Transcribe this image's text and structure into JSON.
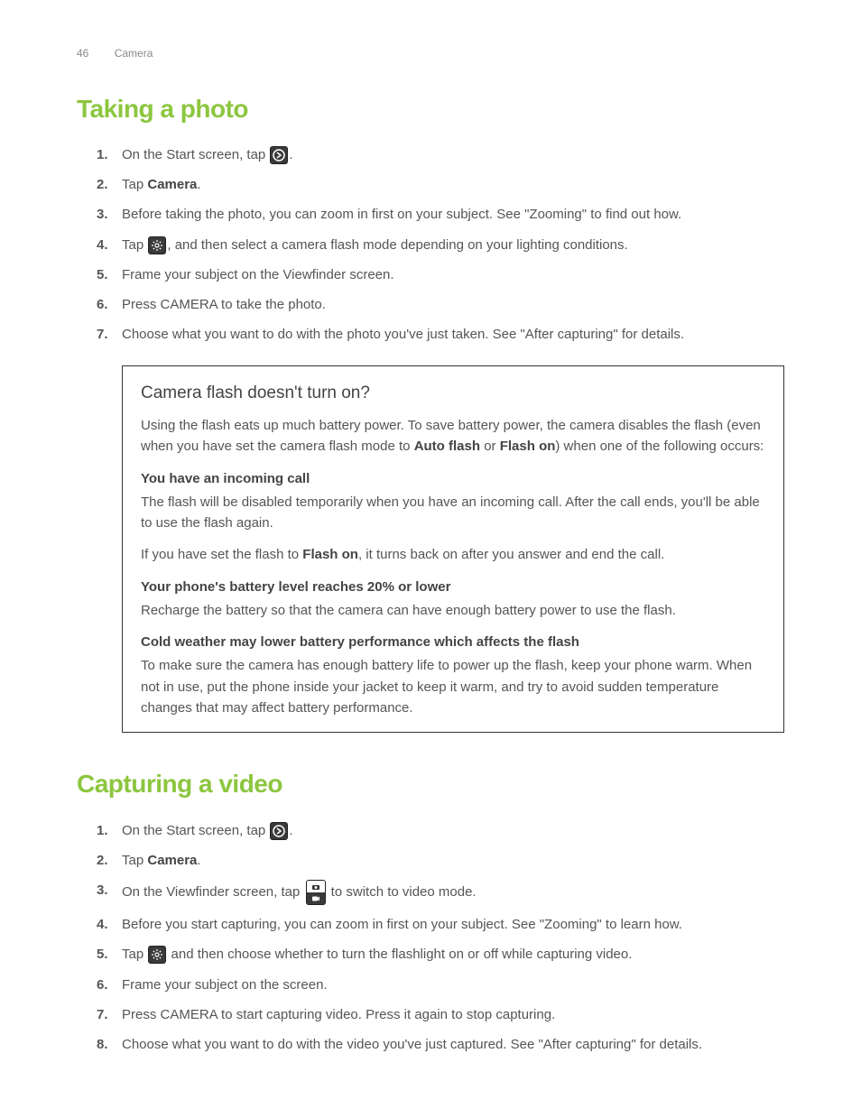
{
  "header": {
    "pageNumber": "46",
    "section": "Camera"
  },
  "section1": {
    "title": "Taking a photo",
    "steps": [
      {
        "pre": "On the Start screen, tap ",
        "icon": "arrow",
        "post": "."
      },
      {
        "pre": "Tap ",
        "bold": "Camera",
        "post2": "."
      },
      {
        "pre": "Before taking the photo, you can zoom in first on your subject. See \"Zooming\" to find out how."
      },
      {
        "pre": "Tap ",
        "icon": "gear",
        "post": ", and then select a camera flash mode depending on your lighting conditions."
      },
      {
        "pre": "Frame your subject on the Viewfinder screen."
      },
      {
        "pre": "Press CAMERA to take the photo."
      },
      {
        "pre": "Choose what you want to do with the photo you've just taken. See \"After capturing\" for details."
      }
    ]
  },
  "callout": {
    "title": "Camera flash doesn't turn on?",
    "intro_pre": "Using the flash eats up much battery power. To save battery power, the camera disables the flash (even when you have set the camera flash mode to ",
    "intro_bold1": "Auto flash",
    "intro_mid": " or ",
    "intro_bold2": "Flash on",
    "intro_post": ") when one of the following occurs:",
    "sub1_title": "You have an incoming call",
    "sub1_text": "The flash will be disabled temporarily when you have an incoming call. After the call ends, you'll be able to use the flash again.",
    "sub1_extra_pre": "If you have set the flash to ",
    "sub1_extra_bold": "Flash on",
    "sub1_extra_post": ", it turns back on after you answer and end the call.",
    "sub2_title": "Your phone's battery level reaches 20% or lower",
    "sub2_text": "Recharge the battery so that the camera can have enough battery power to use the flash.",
    "sub3_title": "Cold weather may lower battery performance which affects the flash",
    "sub3_text": "To make sure the camera has enough battery life to power up the flash, keep your phone warm. When not in use, put the phone inside your jacket to keep it warm, and try to avoid sudden temperature changes that may affect battery performance."
  },
  "section2": {
    "title": "Capturing a video",
    "steps": [
      {
        "pre": "On the Start screen, tap ",
        "icon": "arrow",
        "post": "."
      },
      {
        "pre": "Tap ",
        "bold": "Camera",
        "post2": "."
      },
      {
        "pre": "On the Viewfinder screen, tap ",
        "icon": "switch",
        "post": " to switch to video mode."
      },
      {
        "pre": "Before you start capturing, you can zoom in first on your subject. See \"Zooming\" to learn how."
      },
      {
        "pre": "Tap ",
        "icon": "gear",
        "post": " and then choose whether to turn the flashlight on or off while capturing video."
      },
      {
        "pre": "Frame your subject on the screen."
      },
      {
        "pre": "Press CAMERA to start capturing video. Press it again to stop capturing."
      },
      {
        "pre": "Choose what you want to do with the video you've just captured. See \"After capturing\" for details."
      }
    ]
  }
}
